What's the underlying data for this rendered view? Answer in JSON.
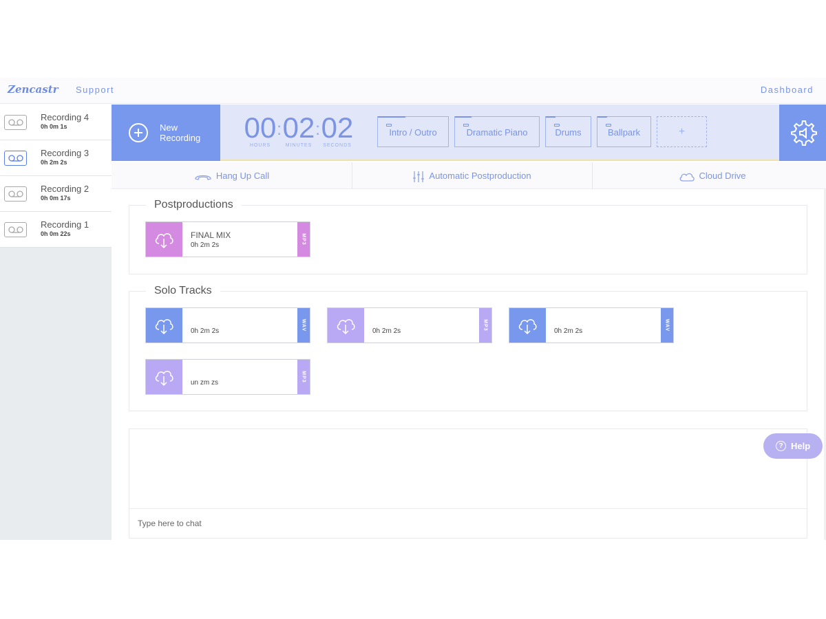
{
  "header": {
    "logo": "Zencastr",
    "support": "Support",
    "dashboard": "Dashboard"
  },
  "sidebar": {
    "recordings": [
      {
        "name": "Recording 4",
        "duration": "0h 0m 1s",
        "active": false
      },
      {
        "name": "Recording 3",
        "duration": "0h 2m 2s",
        "active": true
      },
      {
        "name": "Recording 2",
        "duration": "0h 0m 17s",
        "active": false
      },
      {
        "name": "Recording 1",
        "duration": "0h 0m 22s",
        "active": false
      }
    ]
  },
  "controls": {
    "new_recording_line1": "New",
    "new_recording_line2": "Recording",
    "timer": {
      "hours": "00",
      "minutes": "02",
      "seconds": "02",
      "hours_label": "HOURS",
      "minutes_label": "MINUTES",
      "seconds_label": "SECONDS",
      "separator": ":"
    },
    "soundboard": [
      "Intro / Outro",
      "Dramatic Piano",
      "Drums",
      "Ballpark"
    ],
    "add_sound": "+"
  },
  "actions": {
    "hang_up": "Hang Up Call",
    "postproduction": "Automatic Postproduction",
    "cloud_drive": "Cloud Drive"
  },
  "postproductions": {
    "title": "Postproductions",
    "tracks": [
      {
        "name": "FINAL MIX",
        "duration": "0h 2m 2s",
        "format": "MP3",
        "color": "#d38ae0"
      }
    ]
  },
  "solo_tracks": {
    "title": "Solo Tracks",
    "tracks": [
      {
        "name": "",
        "duration": "0h 2m 2s",
        "format": "WAV",
        "color": "#7898ee"
      },
      {
        "name": "",
        "duration": "0h 2m 2s",
        "format": "MP3",
        "color": "#b9a8f3"
      },
      {
        "name": "",
        "duration": "0h 2m 2s",
        "format": "WAV",
        "color": "#7898ee"
      },
      {
        "name": "",
        "duration": "un zm zs",
        "format": "MP3",
        "color": "#b9a8f3"
      }
    ]
  },
  "chat": {
    "placeholder": "Type here to chat"
  },
  "help": {
    "label": "Help",
    "icon": "?"
  },
  "colors": {
    "accent": "#7898ee",
    "accent_light": "#e1e6f9",
    "text_blue": "#7b94e3",
    "help": "#b7b0f1"
  }
}
